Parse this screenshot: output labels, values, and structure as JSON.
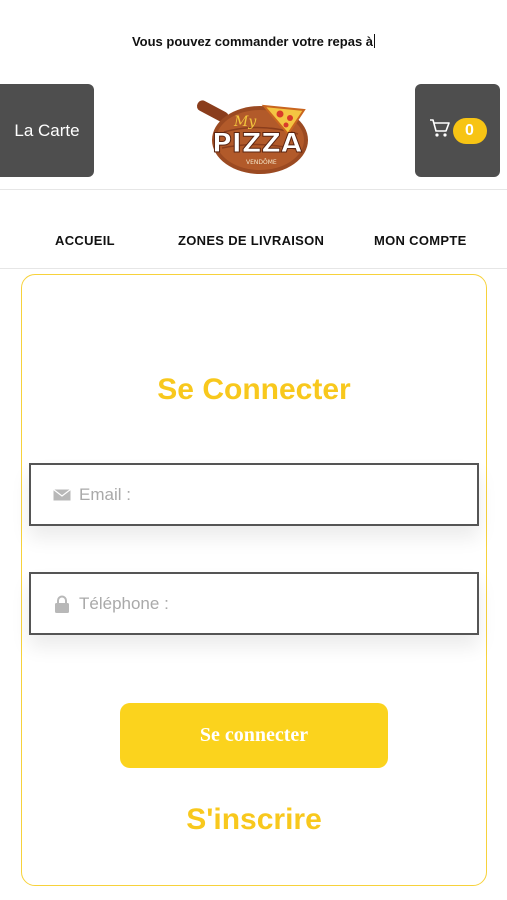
{
  "banner": {
    "text": "Vous pouvez commander votre repas à"
  },
  "header": {
    "menu_label": "La Carte",
    "cart_count": "0",
    "logo": {
      "script_text": "My",
      "name": "PIZZA",
      "subtitle": "VENDÔME"
    }
  },
  "nav": {
    "items": [
      {
        "label": "ACCUEIL"
      },
      {
        "label": "ZONES DE LIVRAISON"
      },
      {
        "label": "MON COMPTE"
      }
    ]
  },
  "login": {
    "title": "Se Connecter",
    "email_placeholder": "Email :",
    "email_value": "",
    "phone_placeholder": "Téléphone :",
    "phone_value": "",
    "submit_label": "Se connecter",
    "register_label": "S'inscrire"
  },
  "colors": {
    "accent": "#f8c81d",
    "button": "#fbd31d",
    "dark_button": "#4e4e4e",
    "card_border": "#f7d23b"
  },
  "icons": {
    "cart": "cart-icon",
    "email": "envelope-icon",
    "phone": "lock-icon"
  }
}
